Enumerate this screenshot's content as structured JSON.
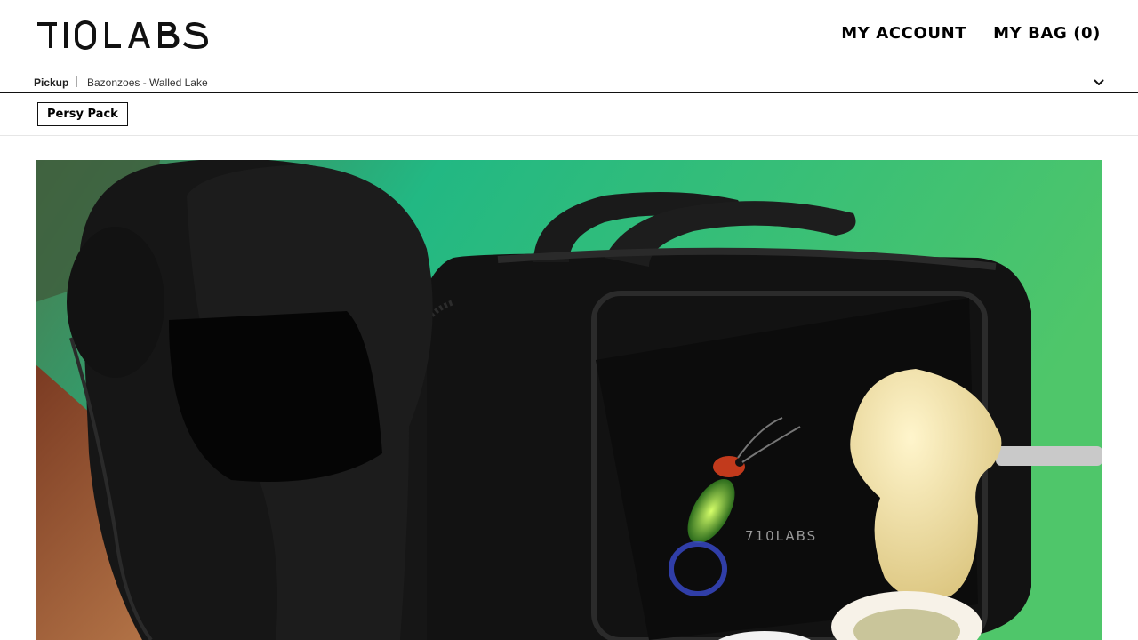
{
  "brand": {
    "logo_text": "710LABS",
    "bag_logo_text": "710LABS"
  },
  "nav": {
    "account_label": "MY ACCOUNT",
    "bag_label": "MY BAG (0)"
  },
  "pickup": {
    "mode_label": "Pickup",
    "store_name": "Bazonzoes - Walled Lake",
    "dropdown_icon": "chevron-down-icon"
  },
  "tags": {
    "active_label": "Persy Pack"
  },
  "hero": {
    "colors": {
      "background_green": "#2fbf86",
      "bag": "#111111",
      "hat": "#161616",
      "rosin": "#efe0a8"
    }
  }
}
